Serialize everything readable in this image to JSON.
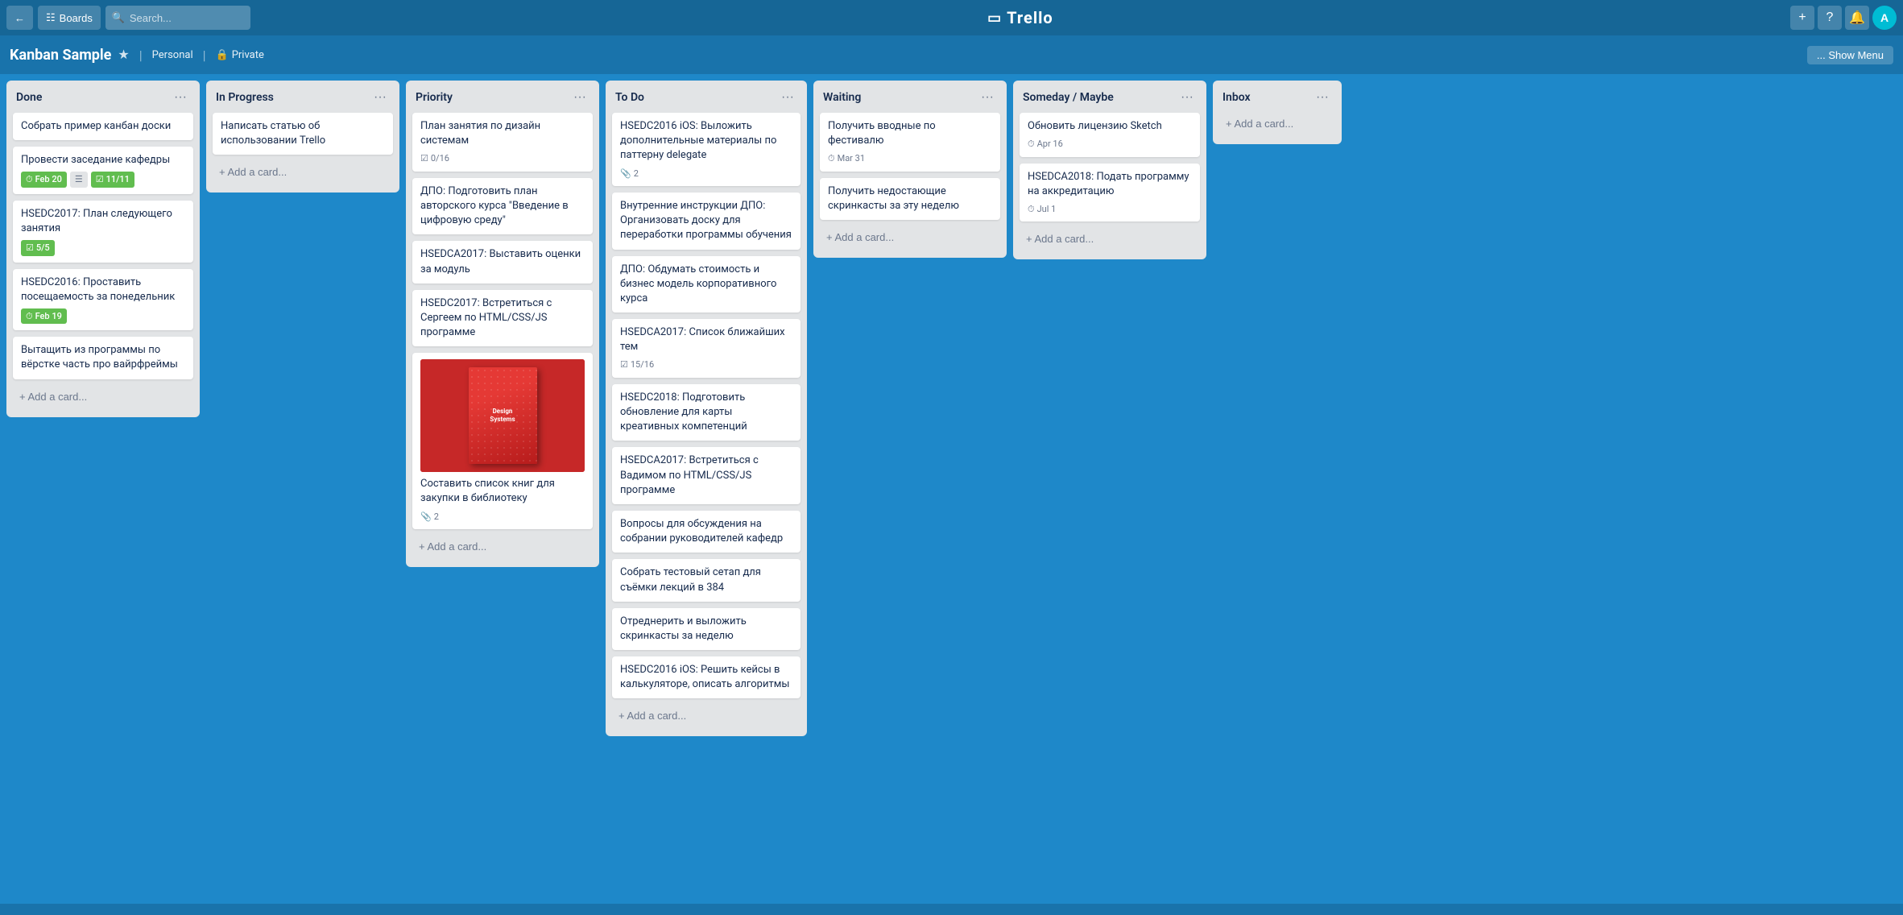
{
  "nav": {
    "boards_label": "Boards",
    "search_placeholder": "Search...",
    "trello_logo": "Trello",
    "add_title": "+",
    "info_title": "?",
    "bell_title": "🔔",
    "show_menu": "Show Menu"
  },
  "board": {
    "title": "Kanban Sample",
    "personal_label": "Personal",
    "private_label": "Private",
    "show_menu_label": "... Show Menu"
  },
  "columns": [
    {
      "id": "done",
      "title": "Done",
      "cards": [
        {
          "text": "Собрать пример канбан доски",
          "badges": []
        },
        {
          "text": "Провести заседание кафедры",
          "badges": [
            {
              "type": "green",
              "text": "Feb 20"
            },
            {
              "type": "gray-icon",
              "text": "≡"
            },
            {
              "type": "green-check",
              "text": "11/11"
            }
          ]
        },
        {
          "text": "HSEDC2017: План следующего занятия",
          "badges": [
            {
              "type": "green-check",
              "text": "5/5"
            }
          ]
        },
        {
          "text": "HSEDC2016: Проставить посещаемость за понедельник",
          "badges": [
            {
              "type": "green",
              "text": "Feb 19"
            }
          ]
        },
        {
          "text": "Вытащить из программы по вёрстке часть про вайрфреймы",
          "badges": []
        }
      ],
      "add_label": "Add a card..."
    },
    {
      "id": "in-progress",
      "title": "In Progress",
      "cards": [
        {
          "text": "Написать статью об использовании Trello",
          "badges": []
        }
      ],
      "add_label": "Add a card..."
    },
    {
      "id": "priority",
      "title": "Priority",
      "cards": [
        {
          "text": "План занятия по дизайн системам",
          "badges": [
            {
              "type": "check-outline",
              "text": "0/16"
            }
          ]
        },
        {
          "text": "ДПО: Подготовить план авторского курса \"Введение в цифровую среду\"",
          "badges": []
        },
        {
          "text": "HSEDCA2017: Выставить оценки за модуль",
          "badges": []
        },
        {
          "text": "HSEDC2017: Встретиться с Сергеем по HTML/CSS/JS программе",
          "badges": []
        },
        {
          "text": "has_image",
          "image": true,
          "image_title": "Design Systems",
          "card_title": "Составить список книг для закупки в библиотеку",
          "badges": [
            {
              "type": "attach",
              "text": "2"
            }
          ]
        }
      ],
      "add_label": "Add a card..."
    },
    {
      "id": "todo",
      "title": "To Do",
      "cards": [
        {
          "text": "HSEDC2016 iOS: Выложить дополнительные материалы по паттерну delegate",
          "badges": [
            {
              "type": "attach",
              "text": "2"
            }
          ]
        },
        {
          "text": "Внутренние инструкции ДПО: Организовать доску для переработки программы обучения",
          "badges": []
        },
        {
          "text": "ДПО: Обдумать стоимость и бизнес модель корпоративного курса",
          "badges": []
        },
        {
          "text": "HSEDCA2017: Список ближайших тем",
          "badges": [
            {
              "type": "check-outline",
              "text": "15/16"
            }
          ]
        },
        {
          "text": "HSEDC2018: Подготовить обновление для карты креативных компетенций",
          "badges": []
        },
        {
          "text": "HSEDCA2017: Встретиться с Вадимом по HTML/CSS/JS программе",
          "badges": []
        },
        {
          "text": "Вопросы для обсуждения на собрании руководителей кафедр",
          "badges": []
        },
        {
          "text": "Собрать тестовый сетап для съёмки лекций в 384",
          "badges": []
        },
        {
          "text": "Отреднерить и выложить скринкасты за неделю",
          "badges": []
        },
        {
          "text": "HSEDC2016 iOS: Решить кейсы в калькуляторе, описать алгоритмы",
          "badges": []
        }
      ],
      "add_label": "Add a card..."
    },
    {
      "id": "waiting",
      "title": "Waiting",
      "cards": [
        {
          "text": "Получить вводные по фестивалю",
          "badges": [
            {
              "type": "clock",
              "text": "Mar 31"
            }
          ]
        },
        {
          "text": "Получить недостающие скринкасты за эту неделю",
          "badges": []
        }
      ],
      "add_label": "Add a card..."
    },
    {
      "id": "someday",
      "title": "Someday / Maybe",
      "cards": [
        {
          "text": "Обновить лицензию Sketch",
          "badges": [
            {
              "type": "clock",
              "text": "Apr 16"
            }
          ]
        },
        {
          "text": "HSEDCA2018: Подать программу на аккредитацию",
          "badges": [
            {
              "type": "clock",
              "text": "Jul 1"
            }
          ]
        }
      ],
      "add_label": "Add a card..."
    },
    {
      "id": "inbox",
      "title": "Inbox",
      "cards": [],
      "add_label": "Add a card..."
    }
  ]
}
